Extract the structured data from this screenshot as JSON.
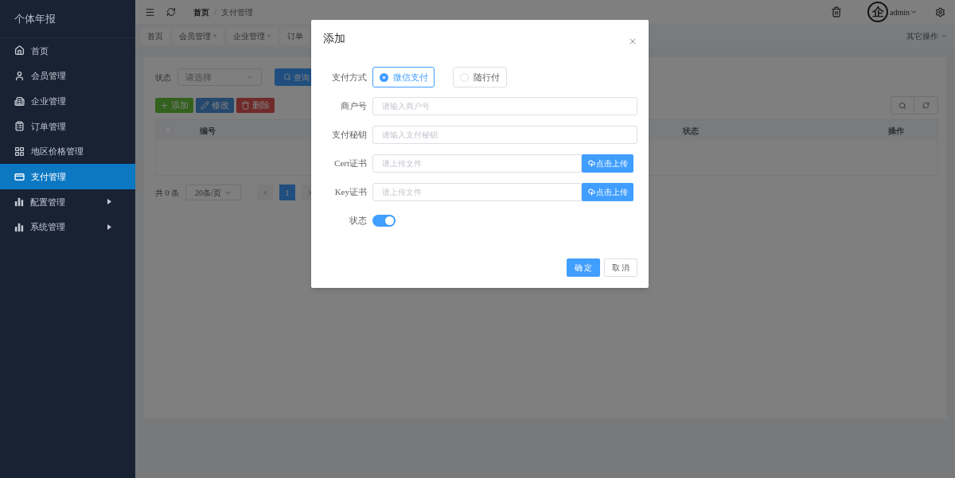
{
  "sidebar": {
    "title": "个体年报",
    "items": [
      {
        "label": "首页",
        "kind": "home",
        "selected": false,
        "submenu": false
      },
      {
        "label": "会员管理",
        "kind": "user",
        "selected": false,
        "submenu": false
      },
      {
        "label": "企业管理",
        "kind": "building",
        "selected": false,
        "submenu": false
      },
      {
        "label": "订单管理",
        "kind": "clipboard",
        "selected": false,
        "submenu": false
      },
      {
        "label": "地区价格管理",
        "kind": "grid",
        "selected": false,
        "submenu": false
      },
      {
        "label": "支付管理",
        "kind": "card",
        "selected": true,
        "submenu": false
      },
      {
        "label": "配置管理",
        "kind": "chart",
        "selected": false,
        "submenu": true
      },
      {
        "label": "系统管理",
        "kind": "chart",
        "selected": false,
        "submenu": true
      }
    ]
  },
  "topbar": {
    "breadcrumb": [
      "首页",
      "支付管理"
    ],
    "separator": "/",
    "avatar": "企",
    "user": "admin"
  },
  "tabs": {
    "items": [
      {
        "label": "首页",
        "closable": false
      },
      {
        "label": "会员管理",
        "closable": true
      },
      {
        "label": "企业管理",
        "closable": true
      },
      {
        "label": "订单",
        "closable": false
      }
    ],
    "other_ops": "其它操作"
  },
  "filter": {
    "label": "状态",
    "placeholder": "请选择",
    "query": "查询"
  },
  "toolbar": [
    {
      "label": "添加",
      "kind": "add"
    },
    {
      "label": "修改",
      "kind": "edit"
    },
    {
      "label": "删除",
      "kind": "delete"
    }
  ],
  "table": {
    "select_all": {
      "checked": false
    },
    "columns": [
      "编号",
      "状态",
      "操作"
    ]
  },
  "pagination": {
    "total": "共 0 条",
    "page_size": "20条/页",
    "pages": [
      {
        "label": "1",
        "selected": true
      }
    ]
  },
  "dialog": {
    "title": "添加",
    "fields": [
      {
        "kind": "radio",
        "label": "支付方式",
        "options": [
          {
            "label": "微信支付",
            "selected": true
          },
          {
            "label": "随行付",
            "selected": false
          }
        ]
      },
      {
        "kind": "text",
        "label": "商户号",
        "placeholder": "请输入商户号"
      },
      {
        "kind": "text",
        "label": "支付秘钥",
        "placeholder": "请输入支付秘钥"
      },
      {
        "kind": "upload",
        "label": "Cert证书",
        "placeholder": "请上传文件",
        "button": "点击上传"
      },
      {
        "kind": "upload",
        "label": "Key证书",
        "placeholder": "请上传文件",
        "button": "点击上传"
      },
      {
        "kind": "switch",
        "label": "状态",
        "on": true
      }
    ],
    "confirm": "确 定",
    "cancel": "取 消"
  }
}
